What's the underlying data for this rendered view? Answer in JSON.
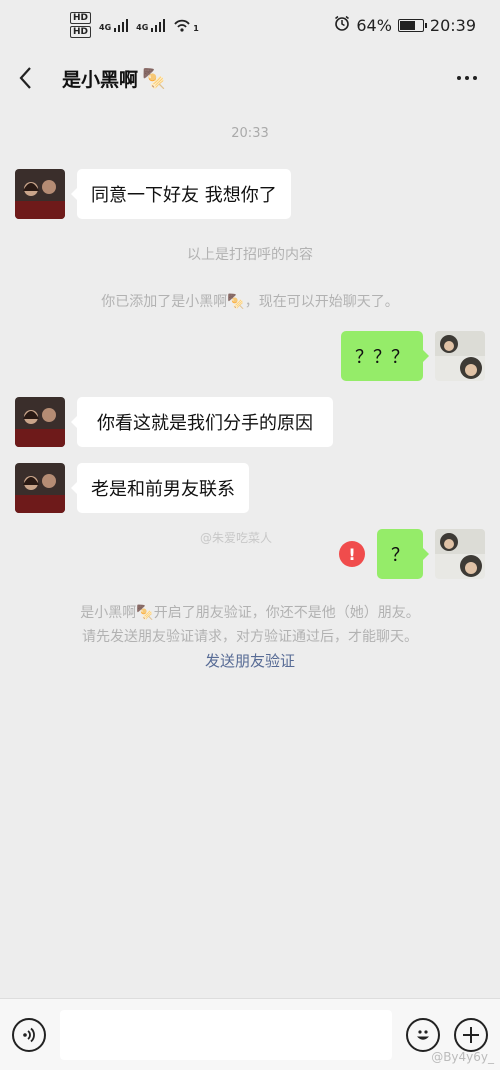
{
  "status_bar": {
    "hd1": "HD",
    "hd2": "HD",
    "net1": "4G",
    "net2": "4G",
    "wifi_badge": "1",
    "battery_text": "64%",
    "battery_level": 0.64,
    "time": "20:39"
  },
  "header": {
    "title": "是小黑啊",
    "title_emoji": "🍢"
  },
  "chat": {
    "timestamp": "20:33",
    "messages": [
      {
        "side": "in",
        "text": "同意一下好友 我想你了"
      },
      {
        "side": "out",
        "text": "？？？"
      },
      {
        "side": "in",
        "text": "你看这就是我们分手的原因"
      },
      {
        "side": "in",
        "text": "老是和前男友联系"
      },
      {
        "side": "out",
        "text": "？",
        "failed": true
      }
    ],
    "sys_greeting_above": "以上是打招呼的内容",
    "sys_added_prefix": "你已添加了是小黑啊",
    "sys_added_suffix": "，现在可以开始聊天了。",
    "error_mark": "!",
    "verify_line1_prefix": "是小黑啊",
    "verify_line1_suffix": "开启了朋友验证，你还不是他（她）朋友。",
    "verify_line2": "请先发送朋友验证请求，对方验证通过后，才能聊天。",
    "verify_link": "发送朋友验证",
    "emoji": "🍢"
  },
  "watermarks": {
    "middle": "@朱爱吃菜人",
    "bottom": "@By4y6y_"
  },
  "colors": {
    "bubble_in": "#ffffff",
    "bubble_out": "#95ec69",
    "background": "#ededed",
    "link": "#576b95",
    "error": "#f04c4c"
  }
}
